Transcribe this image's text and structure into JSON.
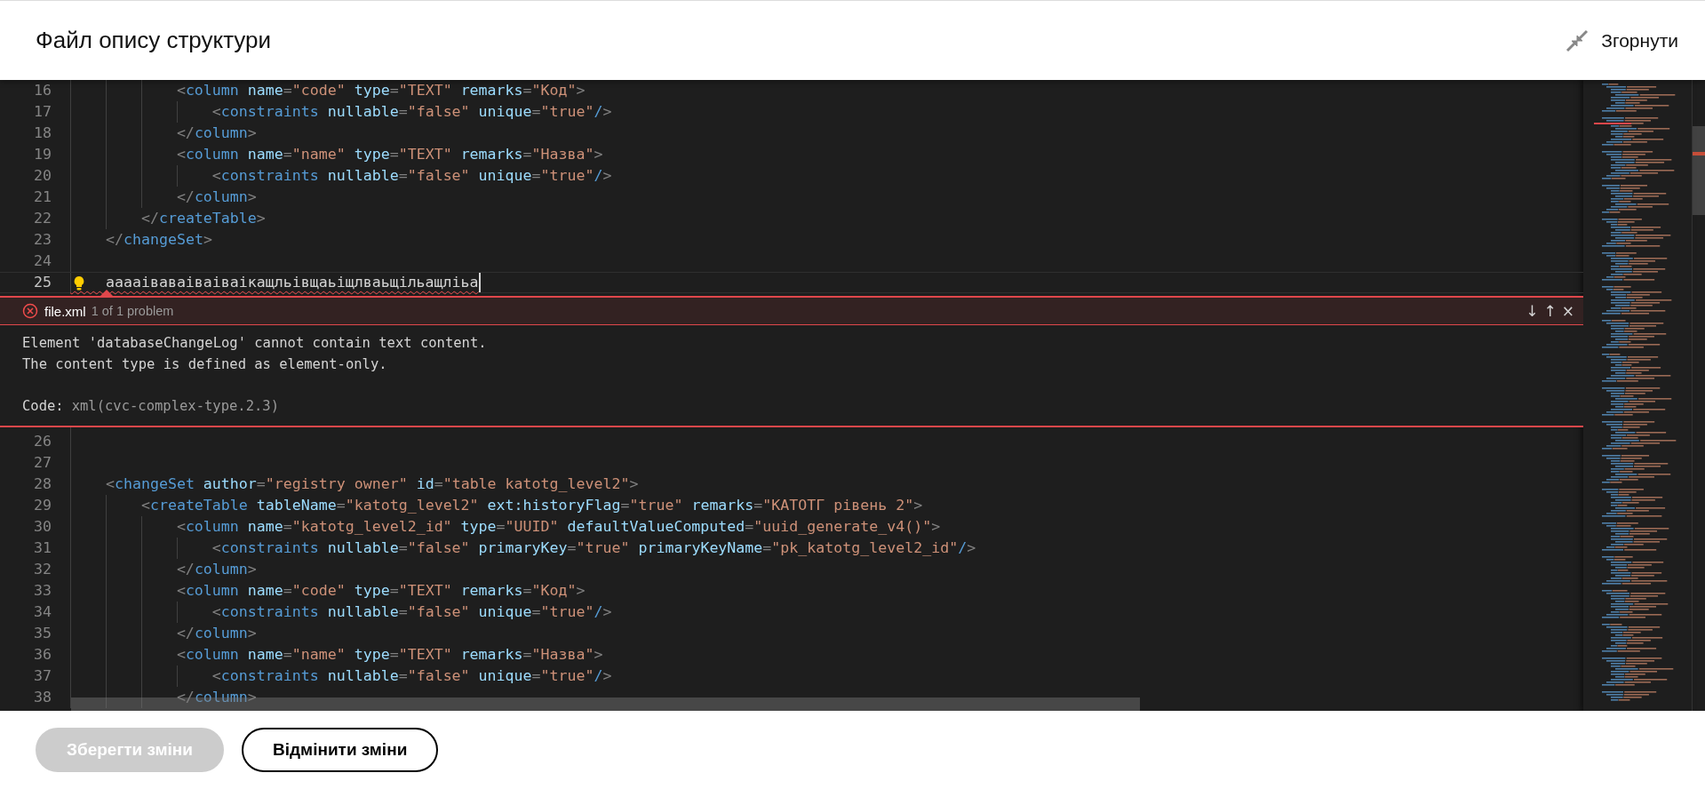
{
  "header": {
    "title": "Файл опису структури",
    "collapse_label": "Згорнути"
  },
  "editor": {
    "lines_before": [
      {
        "number": "16",
        "active": false,
        "error": false,
        "tokens": [
          {
            "kind": "punct",
            "text": "            <"
          },
          {
            "kind": "tag",
            "text": "column"
          },
          {
            "kind": "attr",
            "text": " name"
          },
          {
            "kind": "punct",
            "text": "="
          },
          {
            "kind": "value",
            "text": "\"code\""
          },
          {
            "kind": "attr",
            "text": " type"
          },
          {
            "kind": "punct",
            "text": "="
          },
          {
            "kind": "value",
            "text": "\"TEXT\""
          },
          {
            "kind": "attr",
            "text": " remarks"
          },
          {
            "kind": "punct",
            "text": "="
          },
          {
            "kind": "value",
            "text": "\"Код\""
          },
          {
            "kind": "punct",
            "text": ">"
          }
        ]
      },
      {
        "number": "17",
        "active": false,
        "error": false,
        "tokens": [
          {
            "kind": "punct",
            "text": "                <"
          },
          {
            "kind": "tag",
            "text": "constraints"
          },
          {
            "kind": "attr",
            "text": " nullable"
          },
          {
            "kind": "punct",
            "text": "="
          },
          {
            "kind": "value",
            "text": "\"false\""
          },
          {
            "kind": "attr",
            "text": " unique"
          },
          {
            "kind": "punct",
            "text": "="
          },
          {
            "kind": "value",
            "text": "\"true\""
          },
          {
            "kind": "tag",
            "text": "/"
          },
          {
            "kind": "punct",
            "text": ">"
          }
        ]
      },
      {
        "number": "18",
        "active": false,
        "error": false,
        "tokens": [
          {
            "kind": "punct",
            "text": "            </"
          },
          {
            "kind": "tag",
            "text": "column"
          },
          {
            "kind": "punct",
            "text": ">"
          }
        ]
      },
      {
        "number": "19",
        "active": false,
        "error": false,
        "tokens": [
          {
            "kind": "punct",
            "text": "            <"
          },
          {
            "kind": "tag",
            "text": "column"
          },
          {
            "kind": "attr",
            "text": " name"
          },
          {
            "kind": "punct",
            "text": "="
          },
          {
            "kind": "value",
            "text": "\"name\""
          },
          {
            "kind": "attr",
            "text": " type"
          },
          {
            "kind": "punct",
            "text": "="
          },
          {
            "kind": "value",
            "text": "\"TEXT\""
          },
          {
            "kind": "attr",
            "text": " remarks"
          },
          {
            "kind": "punct",
            "text": "="
          },
          {
            "kind": "value",
            "text": "\"Назва\""
          },
          {
            "kind": "punct",
            "text": ">"
          }
        ]
      },
      {
        "number": "20",
        "active": false,
        "error": false,
        "tokens": [
          {
            "kind": "punct",
            "text": "                <"
          },
          {
            "kind": "tag",
            "text": "constraints"
          },
          {
            "kind": "attr",
            "text": " nullable"
          },
          {
            "kind": "punct",
            "text": "="
          },
          {
            "kind": "value",
            "text": "\"false\""
          },
          {
            "kind": "attr",
            "text": " unique"
          },
          {
            "kind": "punct",
            "text": "="
          },
          {
            "kind": "value",
            "text": "\"true\""
          },
          {
            "kind": "tag",
            "text": "/"
          },
          {
            "kind": "punct",
            "text": ">"
          }
        ]
      },
      {
        "number": "21",
        "active": false,
        "error": false,
        "tokens": [
          {
            "kind": "punct",
            "text": "            </"
          },
          {
            "kind": "tag",
            "text": "column"
          },
          {
            "kind": "punct",
            "text": ">"
          }
        ]
      },
      {
        "number": "22",
        "active": false,
        "error": false,
        "tokens": [
          {
            "kind": "punct",
            "text": "        </"
          },
          {
            "kind": "tag",
            "text": "createTable"
          },
          {
            "kind": "punct",
            "text": ">"
          }
        ]
      },
      {
        "number": "23",
        "active": false,
        "error": false,
        "tokens": [
          {
            "kind": "punct",
            "text": "    </"
          },
          {
            "kind": "tag",
            "text": "changeSet"
          },
          {
            "kind": "punct",
            "text": ">"
          }
        ]
      },
      {
        "number": "24",
        "active": false,
        "error": false
      },
      {
        "number": "25",
        "active": true,
        "error": true,
        "tokens": [
          {
            "kind": "text",
            "text": "    ааааіваваіваіваікащльівщаьіщлваьщільащліьа"
          }
        ]
      }
    ],
    "problem": {
      "file": "file.xml",
      "count": "1 of 1 problem",
      "buttons": [
        "↓",
        "↑",
        "×"
      ],
      "message": [
        "Element 'databaseChangeLog' cannot contain text content.",
        "The content type is defined as element-only."
      ],
      "code_label": "Code:",
      "code_value": "xml(cvc-complex-type.2.3)"
    },
    "lines_after": [
      {
        "number": "26",
        "active": false,
        "error": false
      },
      {
        "number": "27",
        "active": false,
        "error": false
      },
      {
        "number": "28",
        "active": false,
        "error": false,
        "tokens": [
          {
            "kind": "punct",
            "text": "    <"
          },
          {
            "kind": "tag",
            "text": "changeSet"
          },
          {
            "kind": "attr",
            "text": " author"
          },
          {
            "kind": "punct",
            "text": "="
          },
          {
            "kind": "value",
            "text": "\"registry owner\""
          },
          {
            "kind": "attr",
            "text": " id"
          },
          {
            "kind": "punct",
            "text": "="
          },
          {
            "kind": "value",
            "text": "\"table katotg_level2\""
          },
          {
            "kind": "punct",
            "text": ">"
          }
        ]
      },
      {
        "number": "29",
        "active": false,
        "error": false,
        "tokens": [
          {
            "kind": "punct",
            "text": "        <"
          },
          {
            "kind": "tag",
            "text": "createTable"
          },
          {
            "kind": "attr",
            "text": " tableName"
          },
          {
            "kind": "punct",
            "text": "="
          },
          {
            "kind": "value",
            "text": "\"katotg_level2\""
          },
          {
            "kind": "attr",
            "text": " ext:historyFlag"
          },
          {
            "kind": "punct",
            "text": "="
          },
          {
            "kind": "value",
            "text": "\"true\""
          },
          {
            "kind": "attr",
            "text": " remarks"
          },
          {
            "kind": "punct",
            "text": "="
          },
          {
            "kind": "value",
            "text": "\"КАТОТГ рівень 2\""
          },
          {
            "kind": "punct",
            "text": ">"
          }
        ]
      },
      {
        "number": "30",
        "active": false,
        "error": false,
        "tokens": [
          {
            "kind": "punct",
            "text": "            <"
          },
          {
            "kind": "tag",
            "text": "column"
          },
          {
            "kind": "attr",
            "text": " name"
          },
          {
            "kind": "punct",
            "text": "="
          },
          {
            "kind": "value",
            "text": "\"katotg_level2_id\""
          },
          {
            "kind": "attr",
            "text": " type"
          },
          {
            "kind": "punct",
            "text": "="
          },
          {
            "kind": "value",
            "text": "\"UUID\""
          },
          {
            "kind": "attr",
            "text": " defaultValueComputed"
          },
          {
            "kind": "punct",
            "text": "="
          },
          {
            "kind": "value",
            "text": "\"uuid_generate_v4()\""
          },
          {
            "kind": "punct",
            "text": ">"
          }
        ]
      },
      {
        "number": "31",
        "active": false,
        "error": false,
        "tokens": [
          {
            "kind": "punct",
            "text": "                <"
          },
          {
            "kind": "tag",
            "text": "constraints"
          },
          {
            "kind": "attr",
            "text": " nullable"
          },
          {
            "kind": "punct",
            "text": "="
          },
          {
            "kind": "value",
            "text": "\"false\""
          },
          {
            "kind": "attr",
            "text": " primaryKey"
          },
          {
            "kind": "punct",
            "text": "="
          },
          {
            "kind": "value",
            "text": "\"true\""
          },
          {
            "kind": "attr",
            "text": " primaryKeyName"
          },
          {
            "kind": "punct",
            "text": "="
          },
          {
            "kind": "value",
            "text": "\"pk_katotg_level2_id\""
          },
          {
            "kind": "tag",
            "text": "/"
          },
          {
            "kind": "punct",
            "text": ">"
          }
        ]
      },
      {
        "number": "32",
        "active": false,
        "error": false,
        "tokens": [
          {
            "kind": "punct",
            "text": "            </"
          },
          {
            "kind": "tag",
            "text": "column"
          },
          {
            "kind": "punct",
            "text": ">"
          }
        ]
      },
      {
        "number": "33",
        "active": false,
        "error": false,
        "tokens": [
          {
            "kind": "punct",
            "text": "            <"
          },
          {
            "kind": "tag",
            "text": "column"
          },
          {
            "kind": "attr",
            "text": " name"
          },
          {
            "kind": "punct",
            "text": "="
          },
          {
            "kind": "value",
            "text": "\"code\""
          },
          {
            "kind": "attr",
            "text": " type"
          },
          {
            "kind": "punct",
            "text": "="
          },
          {
            "kind": "value",
            "text": "\"TEXT\""
          },
          {
            "kind": "attr",
            "text": " remarks"
          },
          {
            "kind": "punct",
            "text": "="
          },
          {
            "kind": "value",
            "text": "\"Код\""
          },
          {
            "kind": "punct",
            "text": ">"
          }
        ]
      },
      {
        "number": "34",
        "active": false,
        "error": false,
        "tokens": [
          {
            "kind": "punct",
            "text": "                <"
          },
          {
            "kind": "tag",
            "text": "constraints"
          },
          {
            "kind": "attr",
            "text": " nullable"
          },
          {
            "kind": "punct",
            "text": "="
          },
          {
            "kind": "value",
            "text": "\"false\""
          },
          {
            "kind": "attr",
            "text": " unique"
          },
          {
            "kind": "punct",
            "text": "="
          },
          {
            "kind": "value",
            "text": "\"true\""
          },
          {
            "kind": "tag",
            "text": "/"
          },
          {
            "kind": "punct",
            "text": ">"
          }
        ]
      },
      {
        "number": "35",
        "active": false,
        "error": false,
        "tokens": [
          {
            "kind": "punct",
            "text": "            </"
          },
          {
            "kind": "tag",
            "text": "column"
          },
          {
            "kind": "punct",
            "text": ">"
          }
        ]
      },
      {
        "number": "36",
        "active": false,
        "error": false,
        "tokens": [
          {
            "kind": "punct",
            "text": "            <"
          },
          {
            "kind": "tag",
            "text": "column"
          },
          {
            "kind": "attr",
            "text": " name"
          },
          {
            "kind": "punct",
            "text": "="
          },
          {
            "kind": "value",
            "text": "\"name\""
          },
          {
            "kind": "attr",
            "text": " type"
          },
          {
            "kind": "punct",
            "text": "="
          },
          {
            "kind": "value",
            "text": "\"TEXT\""
          },
          {
            "kind": "attr",
            "text": " remarks"
          },
          {
            "kind": "punct",
            "text": "="
          },
          {
            "kind": "value",
            "text": "\"Назва\""
          },
          {
            "kind": "punct",
            "text": ">"
          }
        ]
      },
      {
        "number": "37",
        "active": false,
        "error": false,
        "tokens": [
          {
            "kind": "punct",
            "text": "                <"
          },
          {
            "kind": "tag",
            "text": "constraints"
          },
          {
            "kind": "attr",
            "text": " nullable"
          },
          {
            "kind": "punct",
            "text": "="
          },
          {
            "kind": "value",
            "text": "\"false\""
          },
          {
            "kind": "attr",
            "text": " unique"
          },
          {
            "kind": "punct",
            "text": "="
          },
          {
            "kind": "value",
            "text": "\"true\""
          },
          {
            "kind": "tag",
            "text": "/"
          },
          {
            "kind": "punct",
            "text": ">"
          }
        ]
      },
      {
        "number": "38",
        "active": false,
        "error": false,
        "tokens": [
          {
            "kind": "punct",
            "text": "            </"
          },
          {
            "kind": "tag",
            "text": "column"
          },
          {
            "kind": "punct",
            "text": ">"
          }
        ]
      }
    ]
  },
  "footer": {
    "buttons": [
      {
        "label": "Зберегти зміни",
        "disabled": true
      },
      {
        "label": "Відмінити зміни",
        "disabled": false
      }
    ]
  }
}
